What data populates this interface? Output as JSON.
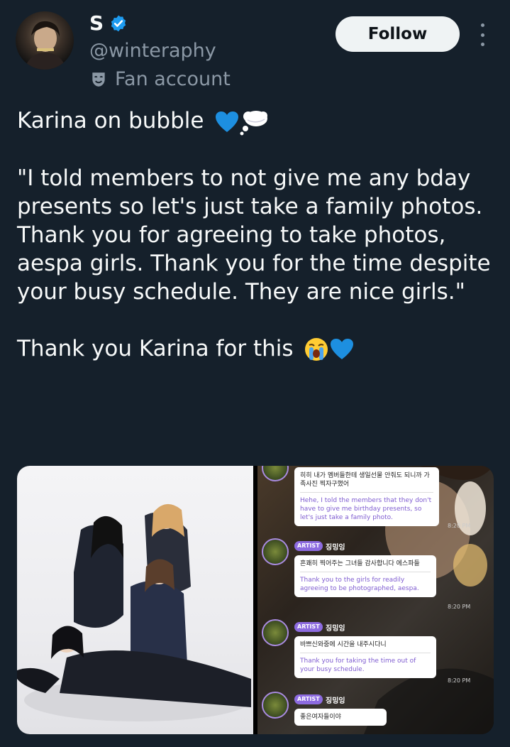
{
  "author": {
    "name": "S",
    "handle": "@winteraphy",
    "label": "Fan account",
    "label_icon": "theater-mask-icon"
  },
  "follow_label": "Follow",
  "tweet": {
    "line1": "Karina on bubble",
    "line1_emoji": [
      "blue-heart",
      "thought-balloon"
    ],
    "quote": "\"I told members to not give me any bday presents so let's just take a family photos. Thank you for agreeing to take photos, aespa girls. Thank you for the time despite your busy schedule. They are nice girls.\"",
    "closing": "Thank you Karina for this",
    "closing_emoji": [
      "loudly-crying-face",
      "blue-heart"
    ]
  },
  "media": {
    "chat": {
      "messages": [
        {
          "korean": "히히 내가 멤버들한테 생일선물 안줘도 되니까 가족사진 찍자구했어",
          "english": "Hehe, I told the members that they don't have to give me birthday presents, so let's just take a family photo.",
          "time": "8:20 PM"
        },
        {
          "tag": "ARTIST",
          "sender": "징밍잉",
          "korean": "흔쾌히 찍어주는 그녀들 감사합니다 에스파들",
          "english": "Thank you to the girls for readily agreeing to be photographed, aespa.",
          "time": "8:20 PM"
        },
        {
          "tag": "ARTIST",
          "sender": "징밍잉",
          "korean": "바쁘신와중에 시간을 내주시다니",
          "english": "Thank you for taking the time out of your busy schedule.",
          "time": "8:20 PM"
        },
        {
          "tag": "ARTIST",
          "sender": "징밍잉",
          "korean": "좋은여자들이야",
          "english": "",
          "time": ""
        }
      ]
    }
  },
  "colors": {
    "background": "#15202b",
    "text": "#f7f9f9",
    "secondary": "#8b98a5",
    "verified": "#1d9bf0",
    "follow_bg": "#eff3f4",
    "chat_accent": "#8d6be0"
  }
}
